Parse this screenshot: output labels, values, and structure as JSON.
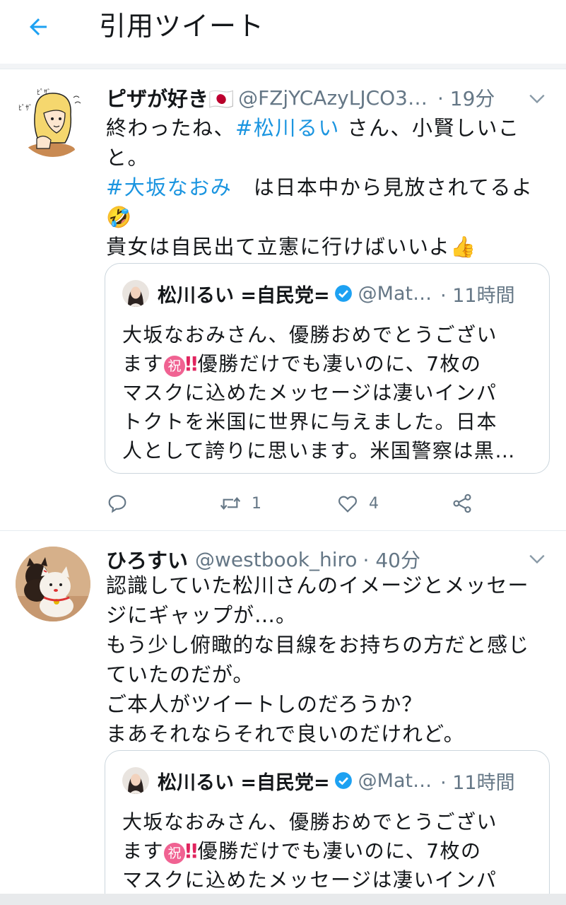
{
  "header": {
    "title": "引用ツイート"
  },
  "tweets": [
    {
      "name": "ピザが好き🇯🇵",
      "handle": "@FZjYCAzyLJCO3…",
      "time": "· 19分",
      "lines": [
        "終わったね、#松川るい さん、小賢しいこ",
        "と。",
        "#大坂なおみ　は日本中から見放されてるよ",
        "🤣",
        "貴女は自民出て立憲に行けばいいよ👍"
      ],
      "quote": {
        "name": "松川るい =自民党=",
        "handle": "@Mat…",
        "time": "· 11時間",
        "lines": [
          "大坂なおみさん、優勝おめでとうござい",
          "ます㊗‼優勝だけでも凄いのに、7枚の",
          "マスクに込めたメッセージは凄いインパ",
          "トクトを米国に世界に与えました。日本",
          "人として誇りに思います。米国警察は黒…"
        ]
      },
      "actions": {
        "reply": "",
        "retweet": "1",
        "like": "4"
      }
    },
    {
      "name": "ひろすい",
      "handle": "@westbook_hiro",
      "time": "· 40分",
      "lines": [
        "認識していた松川さんのイメージとメッセー",
        "ジにギャップが…。",
        "もう少し俯瞰的な目線をお持ちの方だと感じ",
        "ていたのだが。",
        "ご本人がツイートしのだろうか？",
        "まあそれならそれで良いのだけれど。"
      ],
      "quote": {
        "name": "松川るい =自民党=",
        "handle": "@Mat…",
        "time": "· 11時間",
        "lines": [
          "大坂なおみさん、優勝おめでとうござい",
          "ます㊗‼優勝だけでも凄いのに、7枚の",
          "マスクに込めたメッセージは凄いインパ"
        ]
      }
    }
  ],
  "icons": {
    "back": "arrow-left-icon",
    "more": "chevron-down-icon",
    "verified": "verified-badge-icon",
    "reply": "reply-icon",
    "retweet": "retweet-icon",
    "like": "heart-icon",
    "share": "share-icon"
  },
  "colors": {
    "accent": "#1da1f2",
    "hashtag": "#1b95e0",
    "muted": "#657786",
    "border": "#ccd6dd"
  }
}
